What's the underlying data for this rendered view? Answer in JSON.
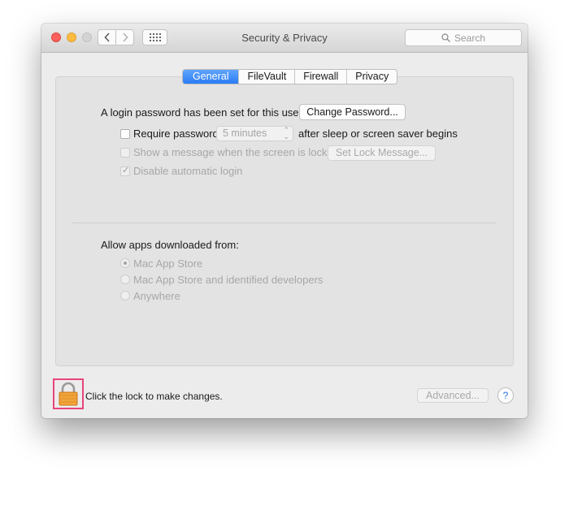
{
  "window": {
    "title": "Security & Privacy"
  },
  "toolbar": {
    "search_placeholder": "Search",
    "back_icon": "chevron-left-icon",
    "forward_icon": "chevron-right-icon",
    "grid_icon": "grid-icon"
  },
  "tabs": [
    {
      "label": "General",
      "active": true
    },
    {
      "label": "FileVault",
      "active": false
    },
    {
      "label": "Firewall",
      "active": false
    },
    {
      "label": "Privacy",
      "active": false
    }
  ],
  "general": {
    "login_password_text": "A login password has been set for this user",
    "change_password_button": "Change Password...",
    "require_password": {
      "label": "Require password",
      "checked": false,
      "delay_value": "5 minutes",
      "suffix": "after sleep or screen saver begins"
    },
    "show_message": {
      "label": "Show a message when the screen is locked",
      "checked": false,
      "button": "Set Lock Message..."
    },
    "disable_auto_login": {
      "label": "Disable automatic login",
      "checked": true
    },
    "allow_apps": {
      "heading": "Allow apps downloaded from:",
      "options": [
        {
          "label": "Mac App Store",
          "selected": true
        },
        {
          "label": "Mac App Store and identified developers",
          "selected": false
        },
        {
          "label": "Anywhere",
          "selected": false
        }
      ]
    }
  },
  "footer": {
    "lock_text": "Click the lock to make changes.",
    "advanced_button": "Advanced...",
    "help_label": "?"
  },
  "colors": {
    "accent": "#2b7cf4",
    "lock_highlight": "#e8457a",
    "lock_body": "#f2a33a"
  }
}
